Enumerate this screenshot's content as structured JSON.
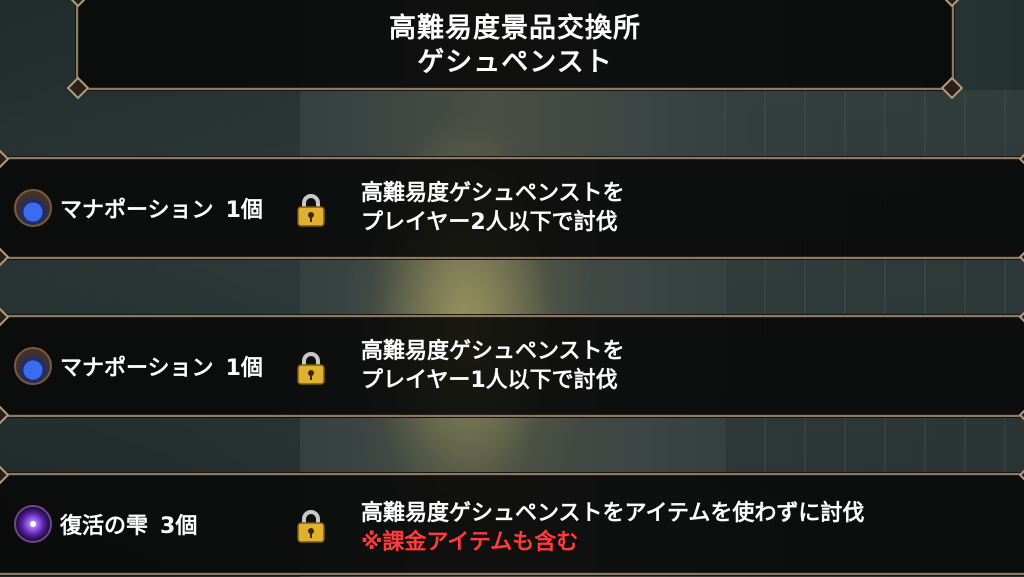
{
  "header": {
    "title_line1": "高難易度景品交換所",
    "title_line2": "ゲシュペンスト"
  },
  "rows": [
    {
      "reward_name": "マナポーション",
      "reward_qty": "1個",
      "reward_icon": "mana-potion-icon",
      "lock_icon": "padlock-icon",
      "condition_line1": "高難易度ゲシュペンストを",
      "condition_line2": "プレイヤー2人以下で討伐"
    },
    {
      "reward_name": "マナポーション",
      "reward_qty": "1個",
      "reward_icon": "mana-potion-icon",
      "lock_icon": "padlock-icon",
      "condition_line1": "高難易度ゲシュペンストを",
      "condition_line2": "プレイヤー1人以下で討伐"
    },
    {
      "reward_name": "復活の雫",
      "reward_qty": "3個",
      "reward_icon": "revival-drop-icon",
      "lock_icon": "padlock-icon",
      "condition_line1": "高難易度ゲシュペンストをアイテムを使わずに討伐",
      "condition_note": "※課金アイテムも含む"
    }
  ],
  "colors": {
    "panel_border": "#8a7a66",
    "note_red": "#ff3b3b",
    "lock_gold": "#e0b030"
  }
}
